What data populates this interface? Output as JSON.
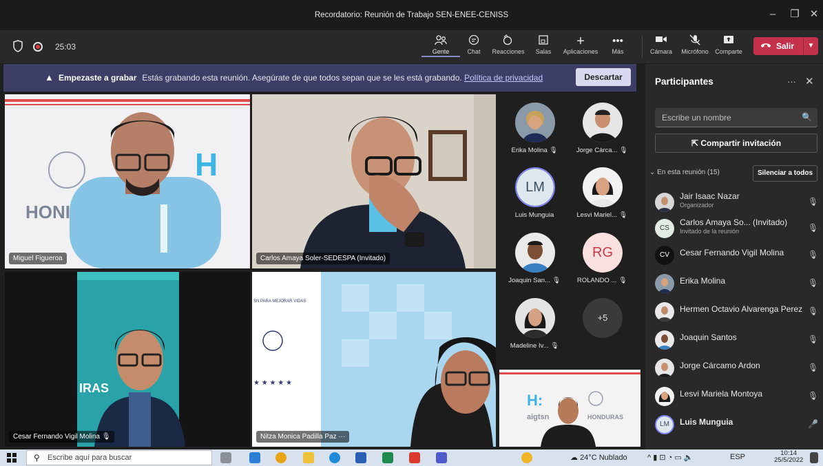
{
  "window": {
    "title": "Recordatorio: Reunión de Trabajo SEN-ENEE-CENISS",
    "minimize": "–",
    "maximize": "❐",
    "close": "✕"
  },
  "toolbar": {
    "timer": "25:03",
    "items": [
      {
        "label": "Gente",
        "icon": "people-icon"
      },
      {
        "label": "Chat",
        "icon": "chat-icon"
      },
      {
        "label": "Reacciones",
        "icon": "reactions-icon"
      },
      {
        "label": "Salas",
        "icon": "rooms-icon"
      },
      {
        "label": "Aplicaciones",
        "icon": "plus-icon"
      },
      {
        "label": "Más",
        "icon": "more-icon"
      },
      {
        "label": "Cámara",
        "icon": "camera-icon"
      },
      {
        "label": "Micrófono",
        "icon": "mic-off-icon"
      },
      {
        "label": "Comparte",
        "icon": "share-icon"
      }
    ],
    "leave_label": "Salir"
  },
  "banner": {
    "bold": "Empezaste a grabar",
    "message": "Estás grabando esta reunión. Asegúrate de que todos sepan que se les está grabando.",
    "link": "Política de privacidad",
    "dismiss": "Descartar"
  },
  "tiles": {
    "t1": "Miguel Figueroa",
    "t2": "Carlos Amaya Soler-SEDESPA (Invitado)",
    "t3": "Cesar Fernando Vigil Molina",
    "t4": "Nitza Monica Padilla Paz"
  },
  "gallery": [
    {
      "name": "Erika Molina"
    },
    {
      "name": "Jorge Cárca..."
    },
    {
      "name": "Luis Munguia",
      "initials": "LM"
    },
    {
      "name": "Lesvi Mariel..."
    },
    {
      "name": "Joaquin San..."
    },
    {
      "name": "ROLANDO ...",
      "initials": "RG"
    },
    {
      "name": "Madeline Iv..."
    },
    {
      "name": "",
      "initials": "+5"
    }
  ],
  "panel": {
    "title": "Participantes",
    "more": "···",
    "close": "✕",
    "search_placeholder": "Escribe un nombre",
    "invite": "Compartir invitación",
    "section": "En esta reunión (15)",
    "mute_all": "Silenciar a todos",
    "participants": [
      {
        "name": "Jair Isaac Nazar",
        "role": "Organizador"
      },
      {
        "name": "Carlos Amaya So... (Invitado)",
        "role": "Invitado de la reunión",
        "initials": "CS"
      },
      {
        "name": "Cesar Fernando Vigil Molina",
        "initials": "CV"
      },
      {
        "name": "Erika Molina"
      },
      {
        "name": "Hermen Octavio Alvarenga Perez"
      },
      {
        "name": "Joaquin Santos"
      },
      {
        "name": "Jorge Cárcamo Ardon"
      },
      {
        "name": "Lesvi Mariela Montoya"
      },
      {
        "name": "Luis Munguia",
        "initials": "LM"
      }
    ]
  },
  "taskbar": {
    "search": "Escribe aquí para buscar",
    "weather": "24°C Nublado",
    "lang": "ESP",
    "time": "10:14",
    "date": "25/5/2022"
  }
}
